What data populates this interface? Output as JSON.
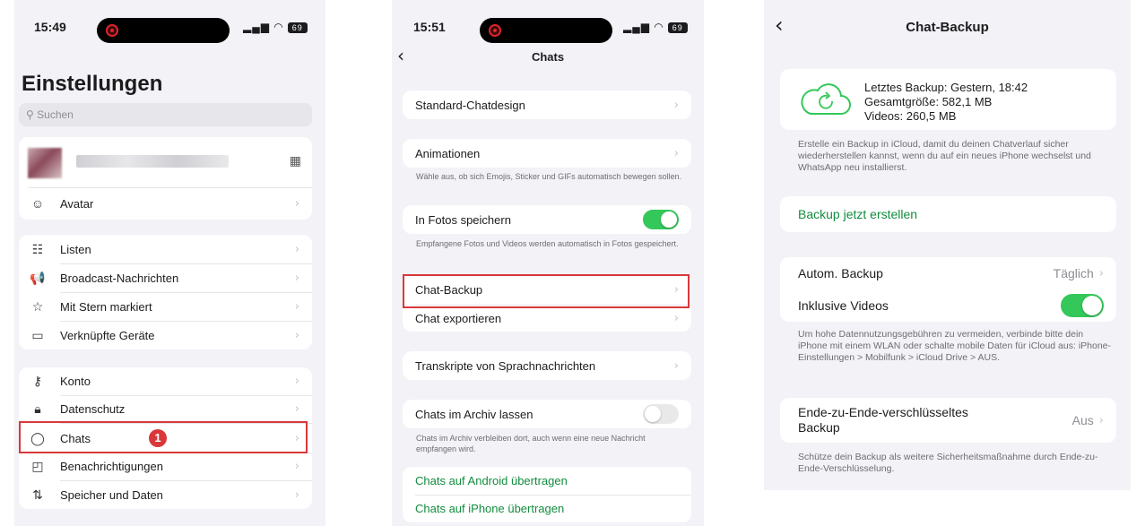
{
  "status_bar": {
    "time_1": "15:49",
    "time_2": "15:51",
    "battery": "69"
  },
  "settings": {
    "title": "Einstellungen",
    "search_placeholder": "Suchen",
    "avatar_label": "Avatar",
    "group_1": [
      "Listen",
      "Broadcast-Nachrichten",
      "Mit Stern markiert",
      "Verknüpfte Geräte"
    ],
    "group_2": [
      "Konto",
      "Datenschutz",
      "Chats",
      "Benachrichtigungen",
      "Speicher und Daten"
    ],
    "step_badge": "1"
  },
  "chats": {
    "title": "Chats",
    "standard_design": "Standard-Chatdesign",
    "animations": "Animationen",
    "animations_note": "Wähle aus, ob sich Emojis, Sticker und GIFs automatisch bewegen sollen.",
    "save_photos": "In Fotos speichern",
    "save_photos_note": "Empfangene Fotos und Videos werden automatisch in Fotos gespeichert.",
    "chat_backup": "Chat-Backup",
    "export_chat": "Chat exportieren",
    "transcripts": "Transkripte von Sprachnachrichten",
    "keep_archived": "Chats im Archiv lassen",
    "keep_archived_note": "Chats im Archiv verbleiben dort, auch wenn eine neue Nachricht empfangen wird.",
    "transfer_android": "Chats auf Android übertragen",
    "transfer_iphone": "Chats auf iPhone übertragen"
  },
  "backup": {
    "title": "Chat-Backup",
    "last_backup": "Letztes Backup: Gestern, 18:42",
    "total_size": "Gesamtgröße: 582,1 MB",
    "videos": "Videos: 260,5 MB",
    "description": "Erstelle ein Backup in iCloud, damit du deinen Chatverlauf sicher wiederherstellen kannst, wenn du auf ein neues iPhone wechselst und WhatsApp neu installierst.",
    "backup_now": "Backup jetzt erstellen",
    "auto_backup": "Autom. Backup",
    "auto_backup_value": "Täglich",
    "include_videos": "Inklusive Videos",
    "data_note": "Um hohe Datennutzungsgebühren zu vermeiden, verbinde bitte dein iPhone mit einem WLAN oder schalte mobile Daten für iCloud aus: iPhone-Einstellungen > Mobilfunk > iCloud Drive > AUS.",
    "e2e_line1": "Ende-zu-Ende-verschlüsseltes",
    "e2e_line2": "Backup",
    "e2e_value": "Aus",
    "e2e_note": "Schütze dein Backup als weitere Sicherheitsmaßnahme durch Ende-zu-Ende-Verschlüsselung."
  },
  "colors": {
    "accent_green": "#34c759",
    "link_green": "#128c3e",
    "highlight_red": "#d9383a"
  }
}
